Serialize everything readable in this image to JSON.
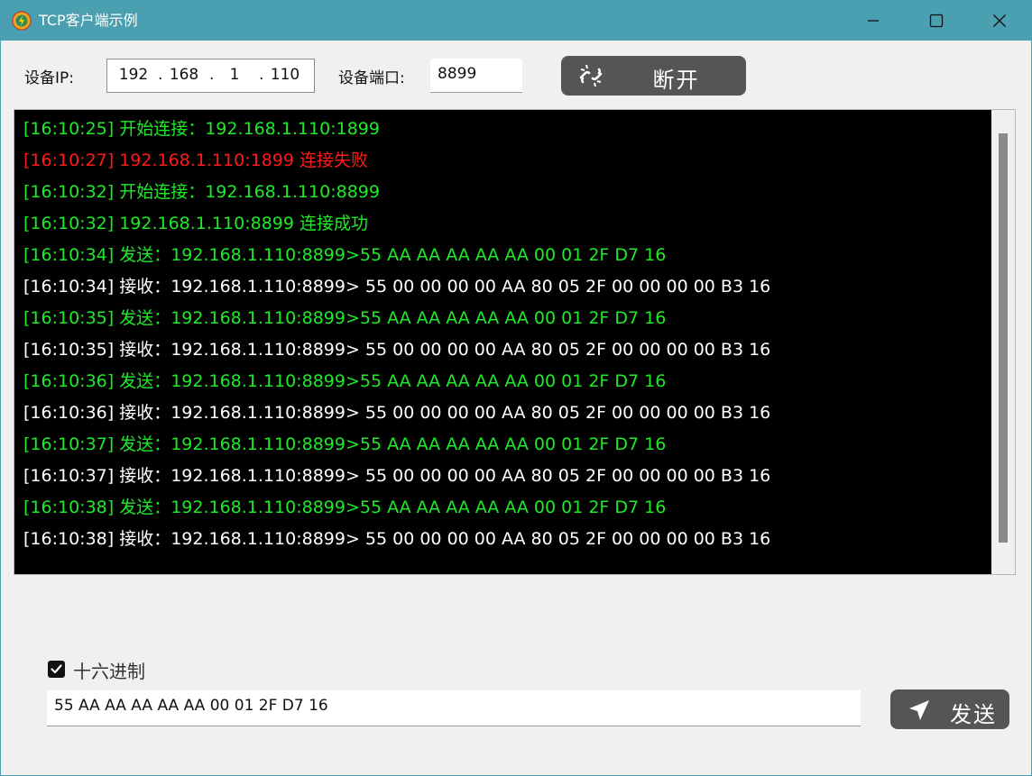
{
  "window": {
    "title": "TCP客户端示例",
    "accent_color": "#4a9fb0"
  },
  "connection": {
    "ip_label": "设备IP:",
    "ip_octets": [
      "192",
      "168",
      "1",
      "110"
    ],
    "port_label": "设备端口:",
    "port_value": "8899",
    "disconnect_label": "断开"
  },
  "log": {
    "lines": [
      {
        "text": "[16:10:25] 开始连接：192.168.1.110:1899",
        "color": "#1eea2a"
      },
      {
        "text": "[16:10:27] 192.168.1.110:1899 连接失败",
        "color": "#ff1a1a"
      },
      {
        "text": "[16:10:32] 开始连接：192.168.1.110:8899",
        "color": "#1eea2a"
      },
      {
        "text": "[16:10:32] 192.168.1.110:8899 连接成功",
        "color": "#1eea2a"
      },
      {
        "text": "[16:10:34] 发送：192.168.1.110:8899>55 AA AA AA AA AA 00 01 2F D7 16",
        "color": "#1eea2a"
      },
      {
        "text": "[16:10:34] 接收：192.168.1.110:8899> 55 00 00 00 00 AA 80 05 2F 00 00 00 00 B3 16",
        "color": "#ffffff"
      },
      {
        "text": "[16:10:35] 发送：192.168.1.110:8899>55 AA AA AA AA AA 00 01 2F D7 16",
        "color": "#1eea2a"
      },
      {
        "text": "[16:10:35] 接收：192.168.1.110:8899> 55 00 00 00 00 AA 80 05 2F 00 00 00 00 B3 16",
        "color": "#ffffff"
      },
      {
        "text": "[16:10:36] 发送：192.168.1.110:8899>55 AA AA AA AA AA 00 01 2F D7 16",
        "color": "#1eea2a"
      },
      {
        "text": "[16:10:36] 接收：192.168.1.110:8899> 55 00 00 00 00 AA 80 05 2F 00 00 00 00 B3 16",
        "color": "#ffffff"
      },
      {
        "text": "[16:10:37] 发送：192.168.1.110:8899>55 AA AA AA AA AA 00 01 2F D7 16",
        "color": "#1eea2a"
      },
      {
        "text": "[16:10:37] 接收：192.168.1.110:8899> 55 00 00 00 00 AA 80 05 2F 00 00 00 00 B3 16",
        "color": "#ffffff"
      },
      {
        "text": "[16:10:38] 发送：192.168.1.110:8899>55 AA AA AA AA AA 00 01 2F D7 16",
        "color": "#1eea2a"
      },
      {
        "text": "[16:10:38] 接收：192.168.1.110:8899> 55 00 00 00 00 AA 80 05 2F 00 00 00 00 B3 16",
        "color": "#ffffff"
      }
    ]
  },
  "send": {
    "hex_label": "十六进制",
    "hex_checked": true,
    "input_value": "55 AA AA AA AA AA 00 01 2F D7 16",
    "send_label": "发送"
  }
}
